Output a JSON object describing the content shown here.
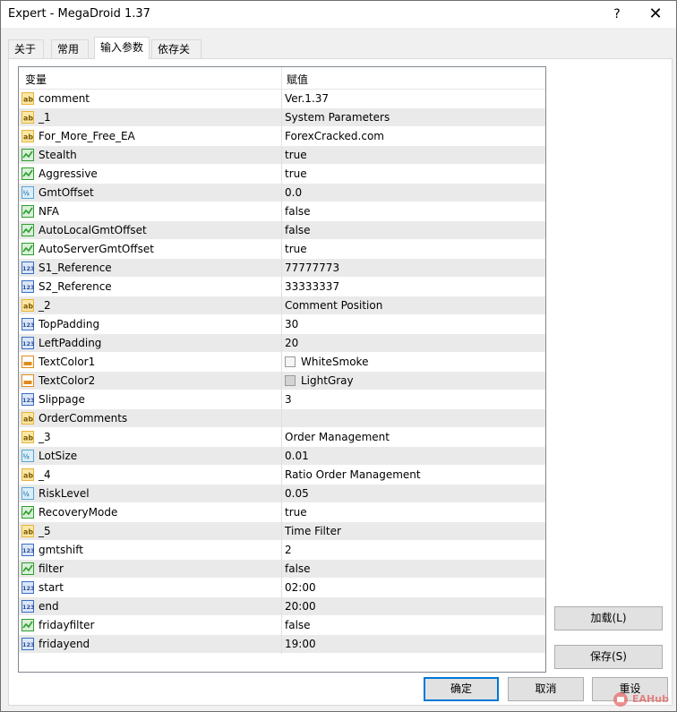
{
  "window": {
    "title": "Expert - MegaDroid 1.37",
    "help_label": "?",
    "close_label": "✕"
  },
  "tabs": [
    {
      "label": "关于"
    },
    {
      "label": "常用"
    },
    {
      "label": "输入参数"
    },
    {
      "label": "依存关系"
    }
  ],
  "active_tab": "输入参数",
  "grid": {
    "header_name": "变量",
    "header_value": "赋值",
    "rows": [
      {
        "icon": "string-icon",
        "name": "comment",
        "value": "Ver.1.37"
      },
      {
        "icon": "string-icon",
        "name": "_1",
        "value": "System Parameters"
      },
      {
        "icon": "string-icon",
        "name": "For_More_Free_EA",
        "value": "ForexCracked.com"
      },
      {
        "icon": "bool-icon",
        "name": "Stealth",
        "value": "true"
      },
      {
        "icon": "bool-icon",
        "name": "Aggressive",
        "value": "true"
      },
      {
        "icon": "double-icon",
        "name": "GmtOffset",
        "value": "0.0"
      },
      {
        "icon": "bool-icon",
        "name": "NFA",
        "value": "false"
      },
      {
        "icon": "bool-icon",
        "name": "AutoLocalGmtOffset",
        "value": "false"
      },
      {
        "icon": "bool-icon",
        "name": "AutoServerGmtOffset",
        "value": "true"
      },
      {
        "icon": "int-icon",
        "name": "S1_Reference",
        "value": "77777773"
      },
      {
        "icon": "int-icon",
        "name": "S2_Reference",
        "value": "33333337"
      },
      {
        "icon": "string-icon",
        "name": "_2",
        "value": "Comment Position"
      },
      {
        "icon": "int-icon",
        "name": "TopPadding",
        "value": "30"
      },
      {
        "icon": "int-icon",
        "name": "LeftPadding",
        "value": "20"
      },
      {
        "icon": "color-icon",
        "name": "TextColor1",
        "value": "WhiteSmoke",
        "swatch": "#f5f5f5"
      },
      {
        "icon": "color-icon",
        "name": "TextColor2",
        "value": "LightGray",
        "swatch": "#d3d3d3"
      },
      {
        "icon": "int-icon",
        "name": "Slippage",
        "value": "3"
      },
      {
        "icon": "string-icon",
        "name": "OrderComments",
        "value": ""
      },
      {
        "icon": "string-icon",
        "name": "_3",
        "value": "Order Management"
      },
      {
        "icon": "double-icon",
        "name": "LotSize",
        "value": "0.01"
      },
      {
        "icon": "string-icon",
        "name": "_4",
        "value": "Ratio Order Management"
      },
      {
        "icon": "double-icon",
        "name": "RiskLevel",
        "value": "0.05"
      },
      {
        "icon": "bool-icon",
        "name": "RecoveryMode",
        "value": "true"
      },
      {
        "icon": "string-icon",
        "name": "_5",
        "value": "Time Filter"
      },
      {
        "icon": "int-icon",
        "name": "gmtshift",
        "value": "2"
      },
      {
        "icon": "bool-icon",
        "name": "filter",
        "value": "false"
      },
      {
        "icon": "int-icon",
        "name": "start",
        "value": "02:00"
      },
      {
        "icon": "int-icon",
        "name": "end",
        "value": "20:00"
      },
      {
        "icon": "bool-icon",
        "name": "fridayfilter",
        "value": "false"
      },
      {
        "icon": "int-icon",
        "name": "fridayend",
        "value": "19:00"
      }
    ]
  },
  "buttons": {
    "load": "加载(L)",
    "save": "保存(S)",
    "ok": "确定",
    "cancel": "取消",
    "reset": "重设"
  },
  "watermark": {
    "text": "EAHub"
  },
  "colors": {
    "accent": "#0078d7",
    "row_alt": "#eaeaea",
    "string_icon": "#e8b43a",
    "bool_icon": "#2e9d2e",
    "int_icon": "#3a6fc4",
    "double_icon": "#5aa6d6",
    "color_icon": "#e08a1e"
  }
}
